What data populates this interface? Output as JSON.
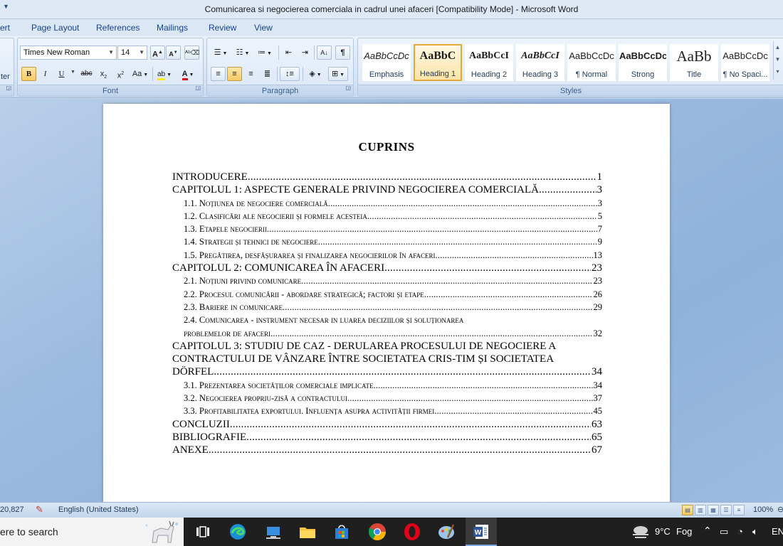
{
  "window": {
    "title": "Comunicarea si negocierea comerciala in cadrul unei afaceri  [Compatibility Mode] - Microsoft Word"
  },
  "ribbon_tabs": [
    "ert",
    "Page Layout",
    "References",
    "Mailings",
    "Review",
    "View"
  ],
  "ribbon": {
    "left_stub_label": "ter",
    "font": {
      "group_label": "Font",
      "family": "Times New Roman",
      "size": "14",
      "grow": "A",
      "shrink": "A",
      "bold": "B",
      "italic": "I",
      "underline": "U",
      "strike": "abc",
      "subscript": "x",
      "superscript": "x",
      "change_case": "Aa",
      "font_color": "A"
    },
    "paragraph": {
      "group_label": "Paragraph",
      "pilcrow": "¶"
    },
    "styles": {
      "group_label": "Styles",
      "tiles": [
        {
          "sample": "AaBbCcDc",
          "name": "Emphasis"
        },
        {
          "sample": "AaBbC",
          "name": "Heading 1"
        },
        {
          "sample": "AaBbCcI",
          "name": "Heading 2"
        },
        {
          "sample": "AaBbCcI",
          "name": "Heading 3"
        },
        {
          "sample": "AaBbCcDc",
          "name": "¶ Normal"
        },
        {
          "sample": "AaBbCcDc",
          "name": "Strong"
        },
        {
          "sample": "AaBb",
          "name": "Title"
        },
        {
          "sample": "AaBbCcDc",
          "name": "¶ No Spaci..."
        }
      ],
      "active_index": 1
    }
  },
  "document": {
    "toc_title": "CUPRINS",
    "entries": [
      {
        "level": 1,
        "text": "INTRODUCERE",
        "page": "1"
      },
      {
        "level": 1,
        "text": "CAPITOLUL 1: ASPECTE GENERALE PRIVIND NEGOCIEREA COMERCIALĂ",
        "page": "3"
      },
      {
        "level": 2,
        "text": "1.1. Noțiunea de negociere comercială",
        "page": "3"
      },
      {
        "level": 2,
        "text": "1.2. Clasificări ale negocierii și formele acesteia",
        "page": "5"
      },
      {
        "level": 2,
        "text": "1.3. Etapele negocierii",
        "page": "7"
      },
      {
        "level": 2,
        "text": "1.4. Strategii și tehnici de negociere",
        "page": "9"
      },
      {
        "level": 2,
        "text": "1.5. Pregătirea, desfășurarea și finalizarea negocierilor în afaceri",
        "page": "13"
      },
      {
        "level": 1,
        "text": "CAPITOLUL 2: COMUNICAREA ÎN AFACERI",
        "page": "23"
      },
      {
        "level": 2,
        "text": "2.1. Noțiuni privind comunicare",
        "page": "23"
      },
      {
        "level": 2,
        "text": "2.2. Procesul comunicării - abordare strategică; factori și etape",
        "page": "26"
      },
      {
        "level": 2,
        "text": "2.3. Bariere in comunicare",
        "page": "29"
      },
      {
        "level": 2,
        "lines": [
          "2.4. Comunicarea - instrument necesar in luarea deciziilor și soluționarea",
          "problemelor de afaceri"
        ],
        "page": "32"
      },
      {
        "level": 1,
        "lines": [
          "CAPITOLUL 3: STUDIU DE CAZ - DERULAREA PROCESULUI DE NEGOCIERE A",
          "CONTRACTULUI DE VÂNZARE ÎNTRE SOCIETATEA CRIS-TIM ȘI SOCIETATEA",
          "DÖRFEL"
        ],
        "page": "34"
      },
      {
        "level": 2,
        "text": "3.1. Prezentarea societăților comerciale implicate",
        "page": "34"
      },
      {
        "level": 2,
        "text": "3.2. Negocierea propriu-zisă a contractului",
        "page": "37"
      },
      {
        "level": 2,
        "text": "3.3. Profitabilitatea exportului. Influența asupra activității firmei",
        "page": "45"
      },
      {
        "level": 1,
        "text": "CONCLUZII",
        "page": "63"
      },
      {
        "level": 1,
        "text": "BIBLIOGRAFIE",
        "page": "65"
      },
      {
        "level": 1,
        "text": "ANEXE",
        "page": "67"
      }
    ]
  },
  "statusbar": {
    "word_count": "20,827",
    "language": "English (United States)",
    "zoom": "100%"
  },
  "taskbar": {
    "search_text": "ere to search",
    "weather_temp": "9°C",
    "weather_desc": "Fog",
    "lang": "EN"
  }
}
